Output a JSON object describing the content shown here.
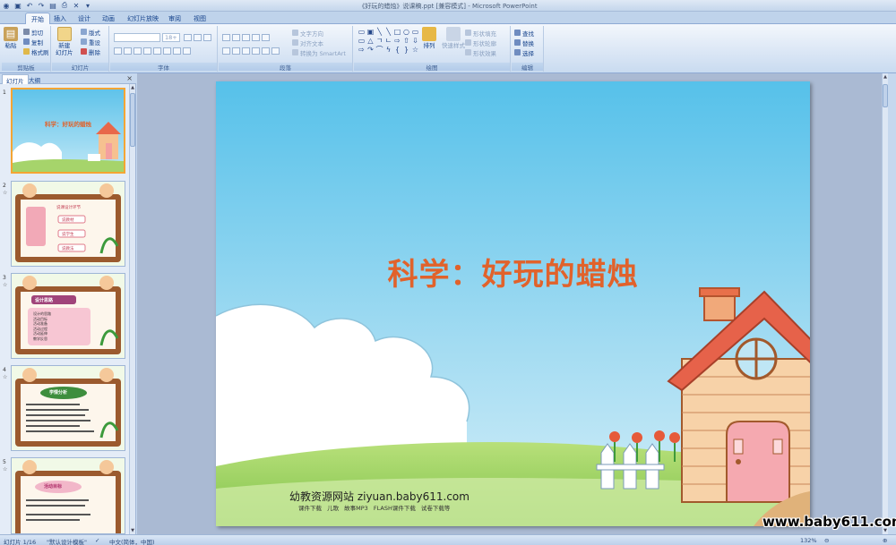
{
  "window": {
    "title": "《好玩的蜡烛》说课稿.ppt [兼容模式] - Microsoft PowerPoint"
  },
  "tabs": [
    "开始",
    "插入",
    "设计",
    "动画",
    "幻灯片放映",
    "审阅",
    "视图"
  ],
  "ribbon": {
    "clipboard": {
      "label": "剪贴板",
      "paste": "粘贴",
      "cut": "剪切",
      "copy": "复制",
      "format_painter": "格式刷"
    },
    "slides": {
      "label": "幻灯片",
      "new_slide": "新建\n幻灯片",
      "layout": "版式",
      "reset": "重设",
      "delete": "删除"
    },
    "font": {
      "label": "字体",
      "size": "18+"
    },
    "paragraph": {
      "label": "段落",
      "text_direction": "文字方向",
      "align_text": "对齐文本",
      "smartart": "转换为 SmartArt"
    },
    "drawing": {
      "label": "绘图",
      "arrange": "排列",
      "quick_styles": "快速样式",
      "shape_fill": "形状填充",
      "shape_outline": "形状轮廓",
      "shape_effects": "形状效果"
    },
    "editing": {
      "label": "编辑",
      "find": "查找",
      "replace": "替换",
      "select": "选择"
    }
  },
  "nav": {
    "tab_slides": "幻灯片",
    "tab_outline": "大纲",
    "close": "×",
    "thumbs": [
      {
        "num": "1",
        "title": "科学：好玩的蜡烛"
      },
      {
        "num": "2",
        "header": "说课设计环节",
        "items": [
          "说教材",
          "说学生",
          "说教法"
        ]
      },
      {
        "num": "3",
        "header": "设计思路",
        "items": [
          "设计的思路",
          "活动目标",
          "活动准备",
          "活动过程",
          "活动延伸",
          "教学反思"
        ]
      },
      {
        "num": "4",
        "header": "学情分析"
      },
      {
        "num": "5",
        "header": "活动目标"
      }
    ]
  },
  "slide": {
    "title": "科学：好玩的蜡烛",
    "footer_site": "幼教资源网站  ziyuan.baby611.com",
    "footer_links": "课件下载 儿歌 故事MP3 FLASH课件下载 试卷下载等"
  },
  "watermark": "www.baby611.com",
  "status": {
    "slide_count": "幻灯片 1/16",
    "theme": "\"默认设计模板\"",
    "language": "中文(简体，中国)",
    "zoom": "132%"
  },
  "colors": {
    "accent": "#e1622b",
    "ribbon": "#dae6f5",
    "selection": "#f4a534"
  }
}
